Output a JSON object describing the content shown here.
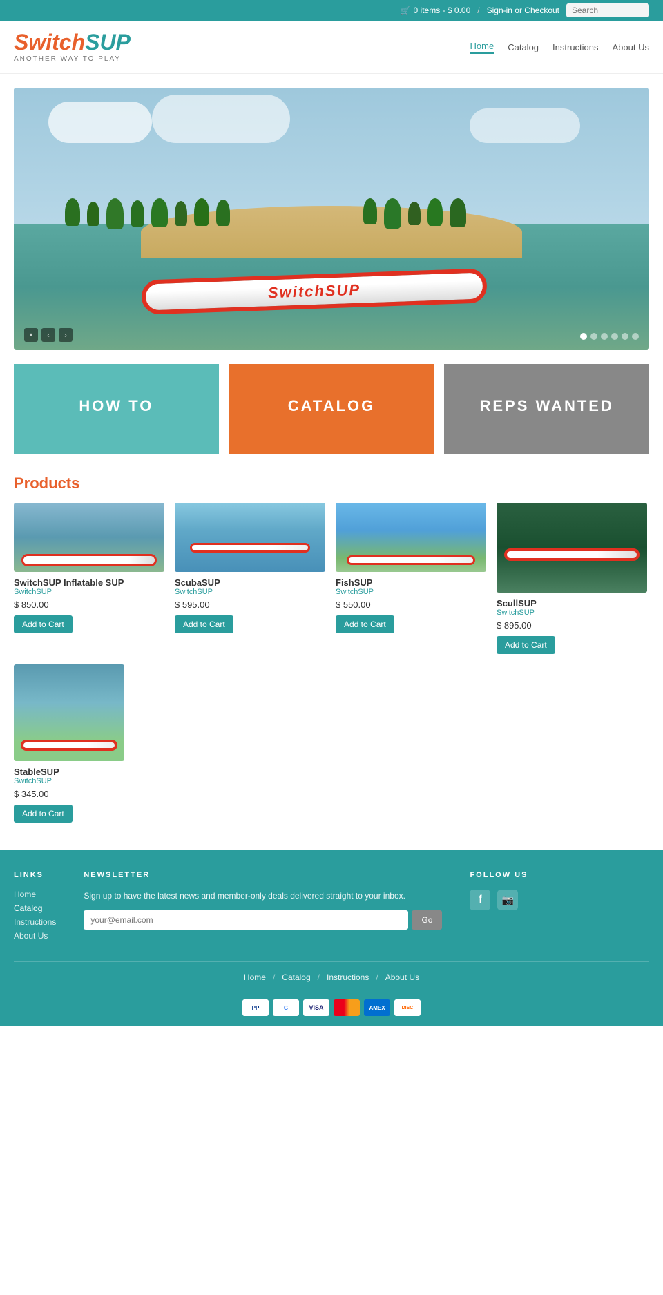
{
  "topbar": {
    "cart_text": "0 items - $ 0.00",
    "auth_text": "Sign-in or Checkout",
    "search_placeholder": "Search"
  },
  "header": {
    "logo_switch": "Switch",
    "logo_sup": "SUP",
    "logo_tagline": "ANOTHER WAY TO PLAY",
    "nav": [
      {
        "label": "Home",
        "active": true
      },
      {
        "label": "Catalog",
        "active": false
      },
      {
        "label": "Instructions",
        "active": false
      },
      {
        "label": "About Us",
        "active": false
      }
    ]
  },
  "hero": {
    "board_text": "SwitchSUP",
    "dots": 6,
    "active_dot": 0
  },
  "categories": [
    {
      "id": "howto",
      "label": "HOW TO",
      "color": "#5bbcb8"
    },
    {
      "id": "catalog",
      "label": "CATALOG",
      "color": "#e8702c"
    },
    {
      "id": "reps",
      "label": "REPS WANTED",
      "color": "#888888"
    }
  ],
  "products_section": {
    "title": "Products",
    "products": [
      {
        "name": "SwitchSUP Inflatable SUP",
        "brand": "SwitchSUP",
        "price": "$ 850.00",
        "add_to_cart": "Add to Cart",
        "img_class": "product-img-1"
      },
      {
        "name": "ScubaSUP",
        "brand": "SwitchSUP",
        "price": "$ 595.00",
        "add_to_cart": "Add to Cart",
        "img_class": "product-img-2"
      },
      {
        "name": "FishSUP",
        "brand": "SwitchSUP",
        "price": "$ 550.00",
        "add_to_cart": "Add to Cart",
        "img_class": "product-img-3"
      },
      {
        "name": "ScullSUP",
        "brand": "SwitchSUP",
        "price": "$ 895.00",
        "add_to_cart": "Add to Cart",
        "img_class": "product-img-4"
      },
      {
        "name": "StableSUP",
        "brand": "SwitchSUP",
        "price": "$ 345.00",
        "add_to_cart": "Add to Cart",
        "img_class": "product-img-5"
      }
    ]
  },
  "footer": {
    "links_heading": "LINKS",
    "newsletter_heading": "NEWSLETTER",
    "social_heading": "FOLLOW US",
    "links": [
      {
        "label": "Home",
        "active": false
      },
      {
        "label": "Catalog",
        "active": true
      },
      {
        "label": "Instructions",
        "active": false
      },
      {
        "label": "About Us",
        "active": false
      }
    ],
    "newsletter_text": "Sign up to have the latest news and member-only deals delivered straight to your inbox.",
    "newsletter_placeholder": "your@email.com",
    "newsletter_btn": "Go",
    "bottom_links": [
      "Home",
      "Catalog",
      "Instructions",
      "About Us"
    ],
    "payment_methods": [
      "PayPal",
      "G Pay",
      "VISA",
      "MC",
      "Amex",
      "Disc"
    ]
  }
}
